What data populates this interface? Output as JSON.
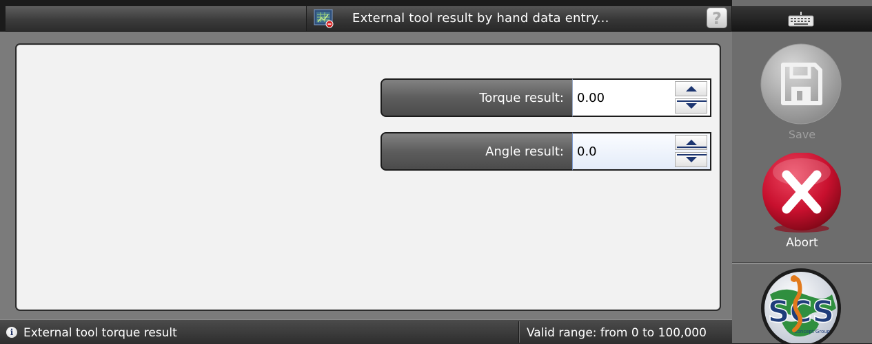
{
  "window": {
    "title": "External tool result by hand data entry...",
    "help_glyph": "?",
    "app_icon": "table-entry-icon"
  },
  "sidebar": {
    "keyboard_icon": "keyboard-icon",
    "save_label": "Save",
    "abort_label": "Abort",
    "logo_text": "SCS",
    "logo_subtext": "Concept Group"
  },
  "form": {
    "torque": {
      "label": "Torque result:",
      "value": "0.00"
    },
    "angle": {
      "label": "Angle result:",
      "value": "0.0"
    }
  },
  "status": {
    "info_icon": "info-icon",
    "message": "External tool torque result",
    "range": "Valid range: from 0 to 100,000"
  },
  "colors": {
    "abort_red": "#c8102e",
    "save_grey": "#b5b5b5",
    "spinner_arrow": "#1c3570"
  }
}
